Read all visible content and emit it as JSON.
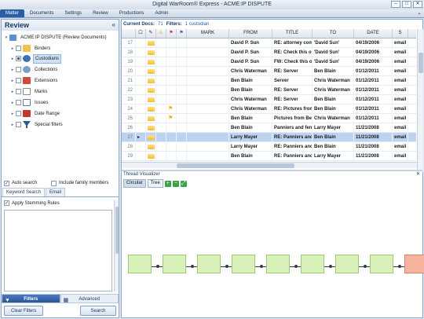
{
  "app": {
    "title": "Digital WarRoom® Express - ACME:IP DISPUTE"
  },
  "menu": {
    "tabs": [
      "Matter",
      "Documents",
      "Settings",
      "Review",
      "Productions",
      "Admin"
    ],
    "active": "Matter"
  },
  "left_panel": {
    "title": "Review",
    "tree": {
      "root": "ACME:IP DISPUTE (Review Documents)",
      "items": [
        {
          "label": "Binders",
          "icon": "binder-icon",
          "color": "#f3c24a"
        },
        {
          "label": "Custodians",
          "icon": "custodian-icon",
          "color": "#3a6fb4"
        },
        {
          "label": "Collections",
          "icon": "collection-icon",
          "color": "#7a9fcc"
        },
        {
          "label": "Extensions",
          "icon": "extension-icon",
          "color": "#d24b3a"
        },
        {
          "label": "Marks",
          "icon": "marks-icon",
          "color": "#8a8a8a"
        },
        {
          "label": "Issues",
          "icon": "issues-icon",
          "color": "#5a7ab0"
        },
        {
          "label": "Date Range",
          "icon": "calendar-icon",
          "color": "#c0392b"
        },
        {
          "label": "Special filters",
          "icon": "filter-icon",
          "color": "#2e5a8c"
        }
      ]
    },
    "options": {
      "auto_search": "Auto search",
      "include_family": "Include family members"
    },
    "search_tabs": [
      "Keyword Search",
      "Email"
    ],
    "stemming": "Apply Stemming Rules",
    "bottom_tabs": [
      "Filters",
      "Advanced"
    ],
    "buttons": {
      "clear": "Clear Filters",
      "search": "Search"
    }
  },
  "grid": {
    "current_docs_label": "Current Docs:",
    "current_docs_value": "71",
    "filters_label": "Filters:",
    "filters_value": "1 custodian",
    "columns": [
      "MARK",
      "FROM",
      "TITLE",
      "TO",
      "DATE",
      "S"
    ],
    "rows": [
      {
        "num": "17",
        "flag": "",
        "from": "David P. Sun",
        "title": "RE: attorney com",
        "to": "'David Sun'",
        "date": "04/19/2006",
        "type": "email"
      },
      {
        "num": "18",
        "flag": "",
        "from": "David P. Sun",
        "title": "RE: Check this ou",
        "to": "'David Sun'",
        "date": "04/19/2006",
        "type": "email"
      },
      {
        "num": "19",
        "flag": "",
        "from": "David P. Sun",
        "title": "FW: Check this o",
        "to": "'David Sun'",
        "date": "04/19/2006",
        "type": "email"
      },
      {
        "num": "20",
        "flag": "",
        "from": "Chris Waterman",
        "title": "RE: Server",
        "to": "Ben Blain",
        "date": "01/12/2011",
        "type": "email"
      },
      {
        "num": "21",
        "flag": "",
        "from": "Ben Blain",
        "title": "Server",
        "to": "Chris Waterman",
        "date": "01/12/2011",
        "type": "email"
      },
      {
        "num": "22",
        "flag": "",
        "from": "Ben Blain",
        "title": "RE: Server",
        "to": "Chris Waterman",
        "date": "01/12/2011",
        "type": "email"
      },
      {
        "num": "23",
        "flag": "",
        "from": "Chris Waterman",
        "title": "RE: Server",
        "to": "Ben Blain",
        "date": "01/12/2011",
        "type": "email"
      },
      {
        "num": "24",
        "flag": "⚑",
        "from": "Chris Waterman",
        "title": "RE: Pictures from",
        "to": "Ben Blain",
        "date": "01/12/2011",
        "type": "email"
      },
      {
        "num": "25",
        "flag": "⚑",
        "from": "Ben Blain",
        "title": "Pictures from Bel",
        "to": "Chris Waterman",
        "date": "01/12/2011",
        "type": "email"
      },
      {
        "num": "26",
        "flag": "",
        "from": "Ben Blain",
        "title": "Panniers and fen",
        "to": "Larry Mayer",
        "date": "11/21/2008",
        "type": "email"
      },
      {
        "num": "27",
        "flag": "",
        "from": "Larry Mayer",
        "title": "RE: Panniers and",
        "to": "Ben Blain",
        "date": "11/21/2008",
        "type": "email",
        "selected": true
      },
      {
        "num": "28",
        "flag": "",
        "from": "Larry Mayer",
        "title": "RE: Panniers and",
        "to": "Ben Blain",
        "date": "11/21/2008",
        "type": "email"
      },
      {
        "num": "29",
        "flag": "",
        "from": "Ben Blain",
        "title": "RE: Panniers and",
        "to": "Larry Mayer",
        "date": "11/21/2008",
        "type": "email"
      }
    ]
  },
  "thread_visualizer": {
    "title": "Thread Visualizer",
    "tabs": [
      "Circular",
      "Tree"
    ],
    "nodes": 9
  }
}
